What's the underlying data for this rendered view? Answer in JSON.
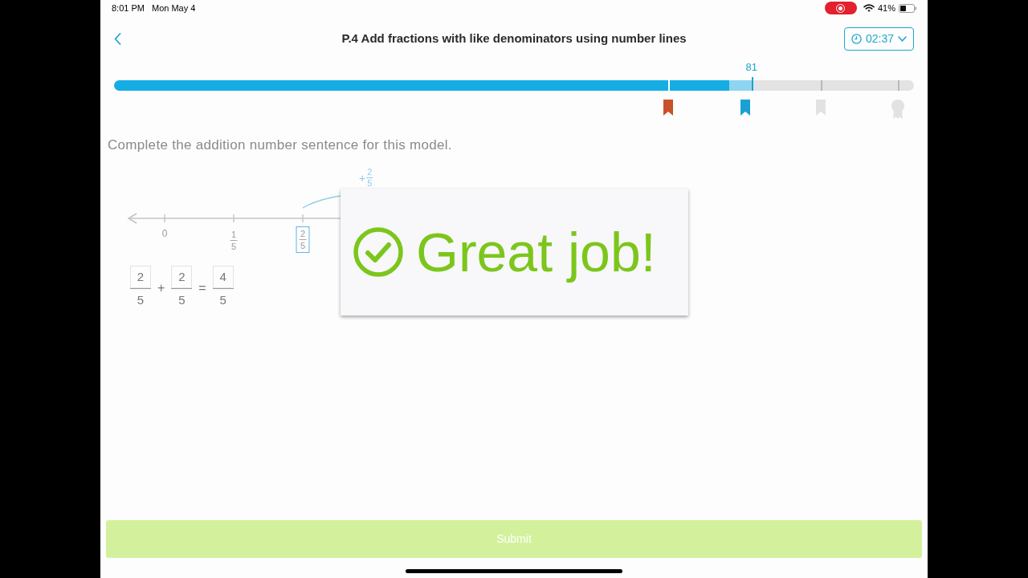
{
  "status_bar": {
    "time": "8:01 PM",
    "date": "Mon May 4",
    "recording": true,
    "battery": "41%"
  },
  "header": {
    "title": "P.4 Add fractions with like denominators using number lines",
    "timer": "02:37"
  },
  "progress": {
    "fill": {
      "level": 0.769
    },
    "gain": {
      "level": 0.797
    },
    "score": "81",
    "milestones": [
      {
        "kind": "ribbon",
        "color": "#c8512a"
      },
      {
        "kind": "ribbon",
        "color": "#1aa0d4"
      },
      {
        "kind": "ribbon",
        "color": "#e2e2e2"
      },
      {
        "kind": "medal",
        "color": "#e2e2e2"
      }
    ]
  },
  "question": {
    "prompt": "Complete the addition number sentence for this model.",
    "number_line": {
      "ticks": [
        {
          "kind": "whole",
          "label": "0",
          "selected": false
        },
        {
          "kind": "fraction",
          "numerator": "1",
          "denominator": "5",
          "selected": false
        },
        {
          "kind": "fraction",
          "numerator": "2",
          "denominator": "5",
          "selected": true
        }
      ],
      "jump": {
        "sign": "+",
        "numerator": "2",
        "denominator": "5"
      }
    },
    "equation": [
      {
        "kind": "fraction",
        "numerator": "2",
        "denominator": "5"
      },
      {
        "kind": "operator",
        "symbol": "+"
      },
      {
        "kind": "fraction",
        "numerator": "2",
        "denominator": "5"
      },
      {
        "kind": "operator",
        "symbol": "="
      },
      {
        "kind": "fraction",
        "numerator": "4",
        "denominator": "5"
      }
    ]
  },
  "feedback": {
    "message": "Great job!",
    "correct": true
  },
  "submit": {
    "label": "Submit",
    "disabled": true
  }
}
